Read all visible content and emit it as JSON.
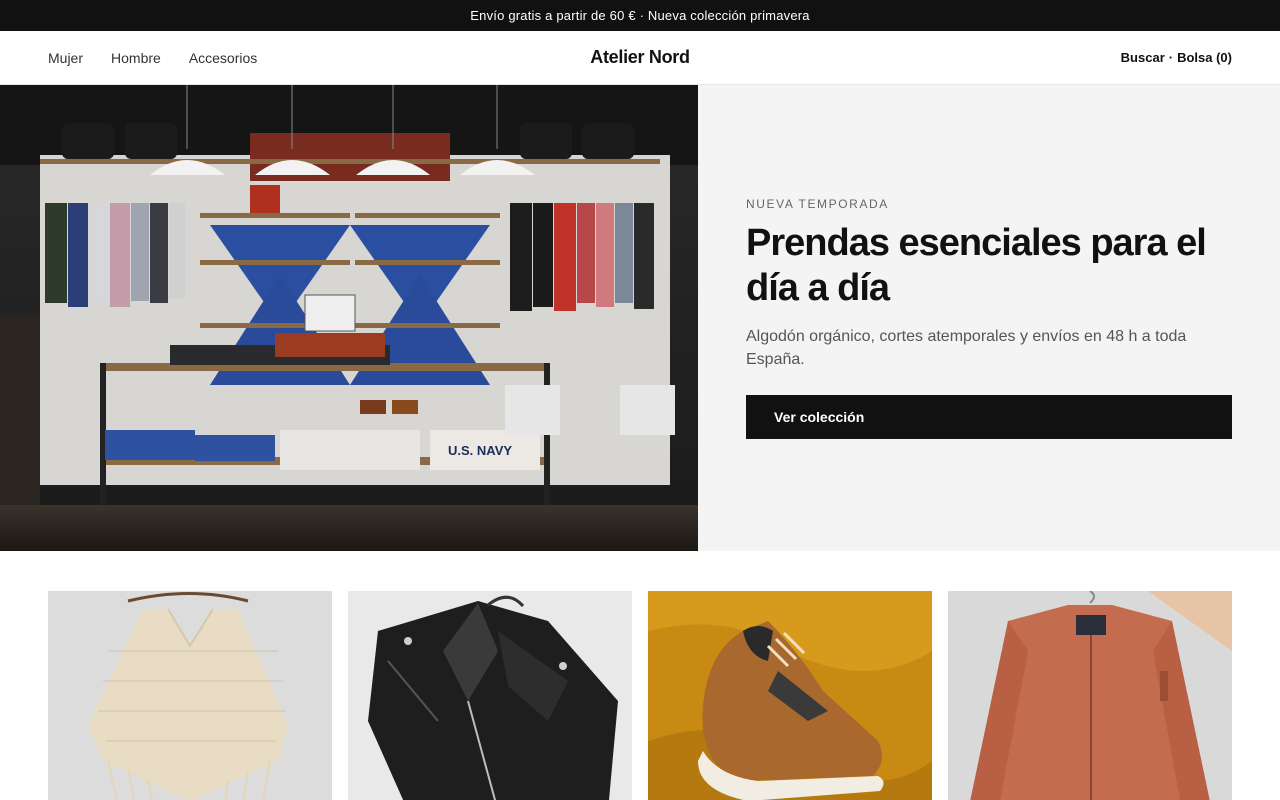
{
  "announcement": "Envío gratis a partir de 60 € · Nueva colección primavera",
  "header": {
    "nav": [
      "Mujer",
      "Hombre",
      "Accesorios"
    ],
    "logo": "Atelier Nord",
    "search_label": "Buscar",
    "separator": "·",
    "bag_label": "Bolsa (0)"
  },
  "hero": {
    "image_alt_text_visible": "U.S. NAVY",
    "eyebrow": "NUEVA TEMPORADA",
    "title": "Prendas esenciales para el día a día",
    "subtitle": "Algodón orgánico, cortes atemporales y envíos en 48 h a toda España.",
    "cta_label": "Ver colección"
  },
  "products": [
    {
      "icon": "knit-poncho-image"
    },
    {
      "icon": "leather-jacket-image"
    },
    {
      "icon": "sneaker-image"
    },
    {
      "icon": "bomber-jacket-image"
    }
  ],
  "colors": {
    "dark": "#111111",
    "panel": "#f4f4f4",
    "muted": "#666666"
  }
}
